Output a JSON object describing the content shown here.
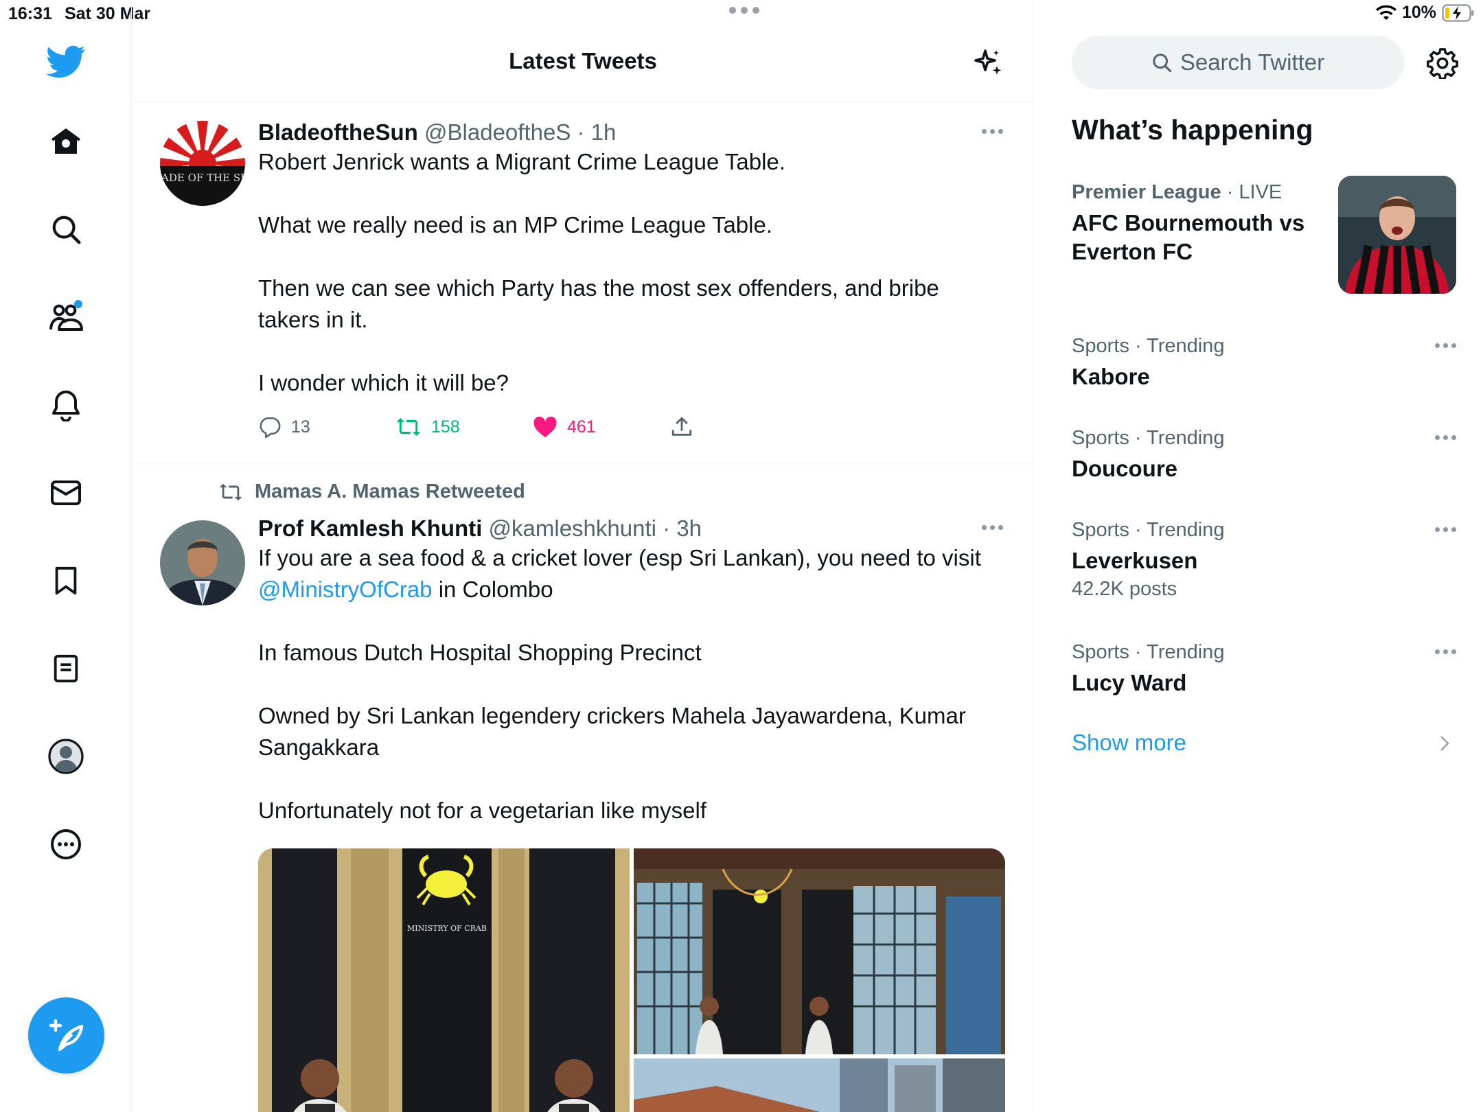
{
  "status_bar": {
    "time": "16:31",
    "date": "Sat 30 Mar",
    "battery": "10%"
  },
  "nav": {
    "items": [
      "home-icon",
      "search-icon",
      "communities-icon",
      "notifications-icon",
      "messages-icon",
      "bookmarks-icon",
      "lists-icon",
      "profile-icon",
      "more-icon"
    ],
    "compose": "compose-icon"
  },
  "header": {
    "title": "Latest Tweets"
  },
  "tweets": [
    {
      "name": "BladeoftheSun",
      "handle": "@BladeoftheS",
      "time": "· 1h",
      "avatar_text": "BLADE OF THE SUN",
      "lines": [
        "Robert Jenrick wants a Migrant Crime League Table.",
        "What we really need is an MP Crime League Table.",
        "Then we can see which Party has the most sex offenders, and bribe takers in it.",
        "I wonder which it will be?"
      ],
      "replies": "13",
      "retweets": "158",
      "likes": "461"
    },
    {
      "retweeted_by": "Mamas A. Mamas Retweeted",
      "name": "Prof Kamlesh Khunti",
      "handle": "@kamleshkhunti",
      "time": "· 3h",
      "line1_pre": "If you are a sea food & a cricket lover (esp Sri Lankan), you need to visit",
      "mention": "@MinistryOfCrab",
      "line1_post": " in Colombo",
      "line2": "In famous Dutch Hospital Shopping Precinct",
      "line3": "Owned by Sri Lankan legendery crickers Mahela Jayawardena, Kumar Sangakkara",
      "line4": "Unfortunately not for a vegetarian like myself",
      "sign_title": "MINISTRY OF CRAB"
    }
  ],
  "right": {
    "search_placeholder": "Search Twitter",
    "section_title": "What’s happening",
    "featured": {
      "category": "Premier League",
      "status": "· LIVE",
      "title": "AFC Bournemouth vs Everton FC"
    },
    "trends": [
      {
        "meta": "Sports · Trending",
        "name": "Kabore",
        "count": ""
      },
      {
        "meta": "Sports · Trending",
        "name": "Doucoure",
        "count": ""
      },
      {
        "meta": "Sports · Trending",
        "name": "Leverkusen",
        "count": "42.2K posts"
      },
      {
        "meta": "Sports · Trending",
        "name": "Lucy Ward",
        "count": ""
      }
    ],
    "show_more": "Show more"
  },
  "colors": {
    "accent": "#1d9bf0",
    "retweet": "#00ba7c",
    "like": "#f91880",
    "secondary_text": "#536471"
  }
}
